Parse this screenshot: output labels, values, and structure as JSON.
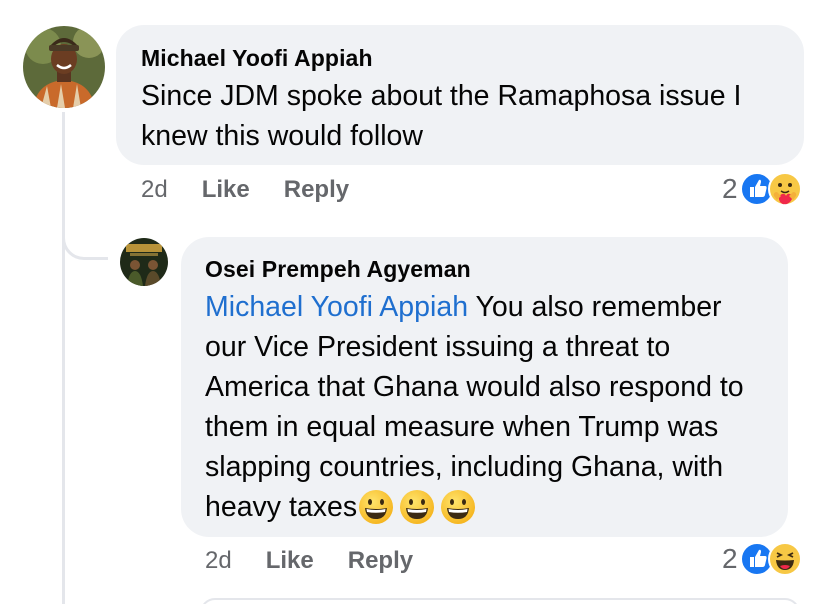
{
  "comments": [
    {
      "author": "Michael Yoofi Appiah",
      "text": "Since JDM spoke about the Ramaphosa issue I knew this would follow",
      "time": "2d",
      "like_label": "Like",
      "reply_label": "Reply",
      "reaction_count": "2",
      "reactions": [
        "like-icon",
        "care-icon"
      ]
    },
    {
      "author": "Osei Prempeh Agyeman",
      "mention": "Michael Yoofi Appiah",
      "text": "You also remember our Vice President issuing a threat to America that Ghana would also respond to them in equal measure when Trump was slapping countries, including Ghana, with heavy taxes",
      "trailing_emojis": [
        "grinning-face-emoji",
        "grinning-face-emoji",
        "grinning-face-emoji"
      ],
      "time": "2d",
      "like_label": "Like",
      "reply_label": "Reply",
      "reaction_count": "2",
      "reactions": [
        "like-icon",
        "haha-icon"
      ]
    }
  ],
  "colors": {
    "bubble": "#f0f2f5",
    "mention": "#1f6fcf",
    "meta": "#65676b",
    "like_blue": "#1877f2",
    "reaction_yellow": "#f7c845"
  }
}
